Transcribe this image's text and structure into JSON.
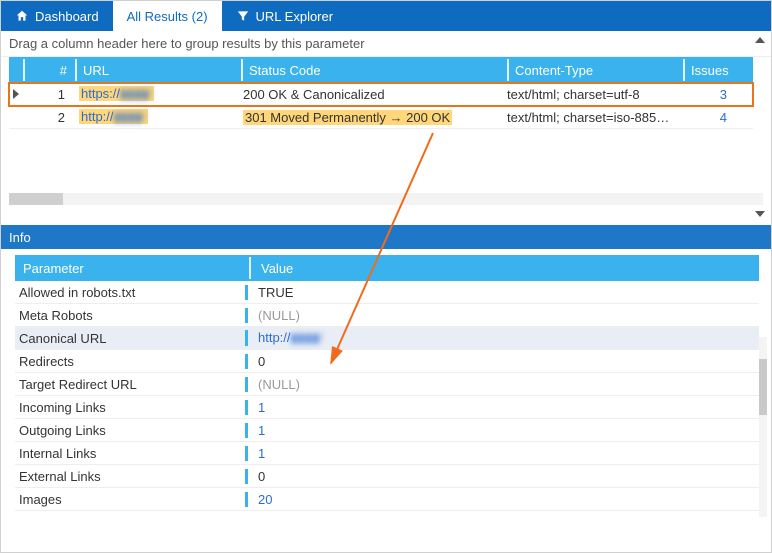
{
  "tabs": {
    "dashboard": "Dashboard",
    "results": "All Results (2)",
    "explorer": "URL Explorer"
  },
  "group_hint": "Drag a column header here to group results by this parameter",
  "columns": {
    "num": "#",
    "url": "URL",
    "status": "Status Code",
    "ctype": "Content-Type",
    "issues": "Issues"
  },
  "rows": [
    {
      "num": "1",
      "url_scheme": "https://",
      "url_rest": "▮▮▮▮/",
      "status": "200 OK & Canonicalized",
      "ctype": "text/html; charset=utf-8",
      "issues": "3"
    },
    {
      "num": "2",
      "url_scheme": "http://",
      "url_rest": "▮▮▮▮/",
      "status": "301 Moved Permanently → 200 OK",
      "ctype": "text/html; charset=iso-885…",
      "issues": "4"
    }
  ],
  "info_title": "Info",
  "param_head": {
    "name": "Parameter",
    "value": "Value"
  },
  "params": [
    {
      "name": "Allowed in robots.txt",
      "value": "TRUE",
      "cls": ""
    },
    {
      "name": "Meta Robots",
      "value": "(NULL)",
      "cls": "null"
    },
    {
      "name": "Canonical URL",
      "value_scheme": "http://",
      "value_rest": "▮▮▮▮/",
      "cls": "linklike",
      "sel": true
    },
    {
      "name": "Redirects",
      "value": "0",
      "cls": ""
    },
    {
      "name": "Target Redirect URL",
      "value": "(NULL)",
      "cls": "null"
    },
    {
      "name": "Incoming Links",
      "value": "1",
      "cls": "linklike"
    },
    {
      "name": "Outgoing Links",
      "value": "1",
      "cls": "linklike"
    },
    {
      "name": "Internal Links",
      "value": "1",
      "cls": "linklike"
    },
    {
      "name": "External Links",
      "value": "0",
      "cls": ""
    },
    {
      "name": "Images",
      "value": "20",
      "cls": "linklike"
    }
  ]
}
